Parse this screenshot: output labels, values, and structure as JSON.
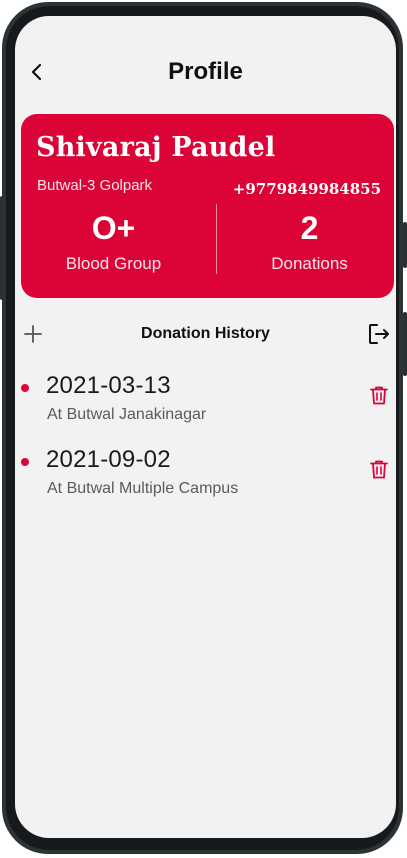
{
  "header": {
    "title": "Profile"
  },
  "profile": {
    "name": "Shivaraj Paudel",
    "address": "Butwal-3 Golpark",
    "phone": "+9779849984855",
    "blood_group": {
      "value": "O+",
      "label": "Blood Group"
    },
    "donations": {
      "value": "2",
      "label": "Donations"
    }
  },
  "history": {
    "title": "Donation History",
    "items": [
      {
        "date": "2021-03-13",
        "place": "At Butwal Janakinagar"
      },
      {
        "date": "2021-09-02",
        "place": "At Butwal Multiple Campus"
      }
    ]
  },
  "icons": {
    "back": "chevron-left-icon",
    "add": "plus-icon",
    "logout": "logout-icon",
    "delete": "trash-icon"
  },
  "colors": {
    "accent": "#dc0337",
    "screen_bg": "#f2f2f2",
    "frame": "#2c3337"
  }
}
